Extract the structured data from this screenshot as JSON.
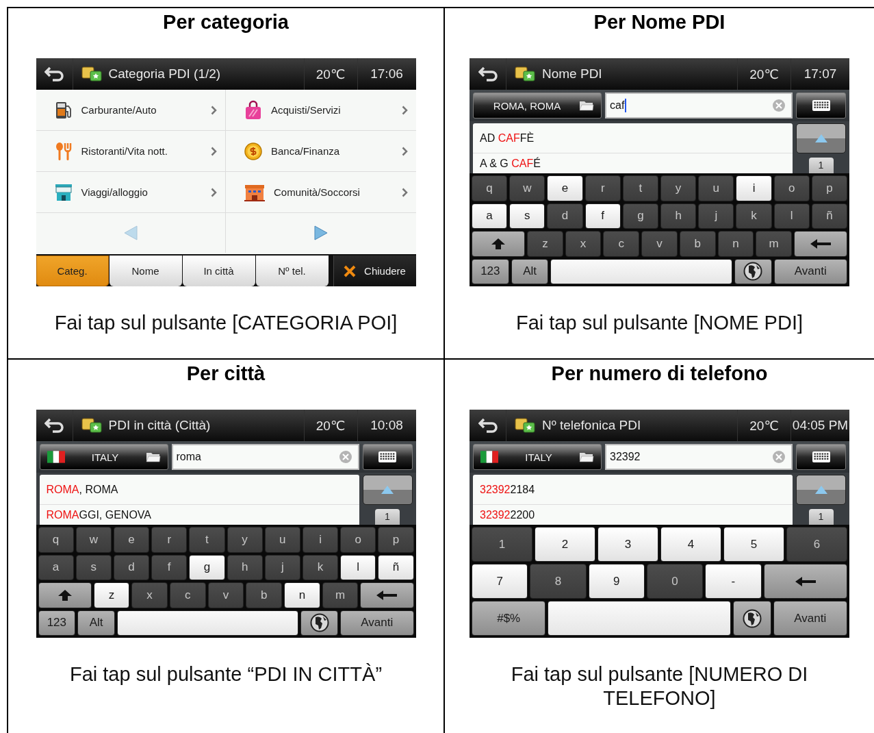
{
  "cells": [
    {
      "heading": "Per categoria",
      "caption": "Fai tap sul pulsante [CATEGORIA POI]",
      "screen": {
        "kind": "category",
        "title": "Categoria PDI (1/2)",
        "temperature": "20℃",
        "time": "17:06",
        "categories": [
          {
            "label": "Carburante/Auto"
          },
          {
            "label": "Acquisti/Servizi"
          },
          {
            "label": "Ristoranti/Vita nott."
          },
          {
            "label": "Banca/Finanza"
          },
          {
            "label": "Viaggi/alloggio"
          },
          {
            "label": "Comunità/Soccorsi"
          }
        ],
        "pager": {
          "previous_enabled": false,
          "next_enabled": true
        },
        "tabs": [
          {
            "label": "Categ.",
            "selected": true
          },
          {
            "label": "Nome",
            "selected": false
          },
          {
            "label": "In città",
            "selected": false
          },
          {
            "label": "Nº tel.",
            "selected": false
          }
        ],
        "close": "Chiudere"
      }
    },
    {
      "heading": "Per Nome PDI",
      "caption": "Fai tap sul pulsante [NOME PDI]",
      "screen": {
        "kind": "search",
        "title": "Nome PDI",
        "temperature": "20℃",
        "time": "17:07",
        "region": {
          "label": "ROMA, ROMA",
          "flag": false
        },
        "query": "caf",
        "cursor": true,
        "results": [
          {
            "before": "AD ",
            "match": "CAF",
            "after": "FÈ"
          },
          {
            "before": "A & G ",
            "match": "CAF",
            "after": "É"
          }
        ],
        "page": "1",
        "keyboard": [
          [
            {
              "kind": "char",
              "label": "q",
              "lit": false
            },
            {
              "kind": "char",
              "label": "w",
              "lit": false
            },
            {
              "kind": "char",
              "label": "e",
              "lit": true
            },
            {
              "kind": "char",
              "label": "r",
              "lit": false
            },
            {
              "kind": "char",
              "label": "t",
              "lit": false
            },
            {
              "kind": "char",
              "label": "y",
              "lit": false
            },
            {
              "kind": "char",
              "label": "u",
              "lit": false
            },
            {
              "kind": "char",
              "label": "i",
              "lit": true
            },
            {
              "kind": "char",
              "label": "o",
              "lit": false
            },
            {
              "kind": "char",
              "label": "p",
              "lit": false
            }
          ],
          [
            {
              "kind": "char",
              "label": "a",
              "lit": true
            },
            {
              "kind": "char",
              "label": "s",
              "lit": true
            },
            {
              "kind": "char",
              "label": "d",
              "lit": false
            },
            {
              "kind": "char",
              "label": "f",
              "lit": true
            },
            {
              "kind": "char",
              "label": "g",
              "lit": false
            },
            {
              "kind": "char",
              "label": "h",
              "lit": false
            },
            {
              "kind": "char",
              "label": "j",
              "lit": false
            },
            {
              "kind": "char",
              "label": "k",
              "lit": false
            },
            {
              "kind": "char",
              "label": "l",
              "lit": false
            },
            {
              "kind": "char",
              "label": "ñ",
              "lit": false
            }
          ],
          [
            {
              "kind": "shift"
            },
            {
              "kind": "char",
              "label": "z",
              "lit": false
            },
            {
              "kind": "char",
              "label": "x",
              "lit": false
            },
            {
              "kind": "char",
              "label": "c",
              "lit": false
            },
            {
              "kind": "char",
              "label": "v",
              "lit": false
            },
            {
              "kind": "char",
              "label": "b",
              "lit": false
            },
            {
              "kind": "char",
              "label": "n",
              "lit": false
            },
            {
              "kind": "char",
              "label": "m",
              "lit": false
            },
            {
              "kind": "back"
            }
          ],
          [
            {
              "kind": "function",
              "label": "123"
            },
            {
              "kind": "function",
              "label": "Alt"
            },
            {
              "kind": "space"
            },
            {
              "kind": "globe"
            },
            {
              "kind": "function",
              "label": "Avanti"
            }
          ]
        ]
      }
    },
    {
      "heading": "Per città",
      "caption": "Fai tap sul pulsante “PDI IN CITTÀ”",
      "screen": {
        "kind": "search",
        "title": "PDI in città (Città)",
        "temperature": "20℃",
        "time": "10:08",
        "region": {
          "label": "ITALY",
          "flag": true
        },
        "query": "roma",
        "cursor": false,
        "results": [
          {
            "match": "ROMA",
            "after": ", ROMA"
          },
          {
            "match": "ROMA",
            "after": "GGI, GENOVA"
          }
        ],
        "page": "1",
        "keyboard": [
          [
            {
              "kind": "char",
              "label": "q",
              "lit": false
            },
            {
              "kind": "char",
              "label": "w",
              "lit": false
            },
            {
              "kind": "char",
              "label": "e",
              "lit": false
            },
            {
              "kind": "char",
              "label": "r",
              "lit": false
            },
            {
              "kind": "char",
              "label": "t",
              "lit": false
            },
            {
              "kind": "char",
              "label": "y",
              "lit": false
            },
            {
              "kind": "char",
              "label": "u",
              "lit": false
            },
            {
              "kind": "char",
              "label": "i",
              "lit": false
            },
            {
              "kind": "char",
              "label": "o",
              "lit": false
            },
            {
              "kind": "char",
              "label": "p",
              "lit": false
            }
          ],
          [
            {
              "kind": "char",
              "label": "a",
              "lit": false
            },
            {
              "kind": "char",
              "label": "s",
              "lit": false
            },
            {
              "kind": "char",
              "label": "d",
              "lit": false
            },
            {
              "kind": "char",
              "label": "f",
              "lit": false
            },
            {
              "kind": "char",
              "label": "g",
              "lit": true
            },
            {
              "kind": "char",
              "label": "h",
              "lit": false
            },
            {
              "kind": "char",
              "label": "j",
              "lit": false
            },
            {
              "kind": "char",
              "label": "k",
              "lit": false
            },
            {
              "kind": "char",
              "label": "l",
              "lit": true
            },
            {
              "kind": "char",
              "label": "ñ",
              "lit": true
            }
          ],
          [
            {
              "kind": "shift"
            },
            {
              "kind": "char",
              "label": "z",
              "lit": true
            },
            {
              "kind": "char",
              "label": "x",
              "lit": false
            },
            {
              "kind": "char",
              "label": "c",
              "lit": false
            },
            {
              "kind": "char",
              "label": "v",
              "lit": false
            },
            {
              "kind": "char",
              "label": "b",
              "lit": false
            },
            {
              "kind": "char",
              "label": "n",
              "lit": true
            },
            {
              "kind": "char",
              "label": "m",
              "lit": false
            },
            {
              "kind": "back"
            }
          ],
          [
            {
              "kind": "function",
              "label": "123"
            },
            {
              "kind": "function",
              "label": "Alt"
            },
            {
              "kind": "space"
            },
            {
              "kind": "globe"
            },
            {
              "kind": "function",
              "label": "Avanti"
            }
          ]
        ]
      }
    },
    {
      "heading": "Per numero di telefono",
      "caption": "Fai tap sul pulsante [NUMERO DI TELEFONO]",
      "screen": {
        "kind": "search",
        "title": "Nº telefonica PDI",
        "temperature": "20℃",
        "time": "04:05 PM",
        "region": {
          "label": "ITALY",
          "flag": true
        },
        "query": "32392",
        "cursor": false,
        "results": [
          {
            "match": "32392",
            "after": "2184"
          },
          {
            "match": "32392",
            "after": "2200"
          }
        ],
        "page": "1",
        "keyboard": [
          [
            {
              "kind": "char",
              "label": "1",
              "lit": false
            },
            {
              "kind": "char",
              "label": "2",
              "lit": true
            },
            {
              "kind": "char",
              "label": "3",
              "lit": true
            },
            {
              "kind": "char",
              "label": "4",
              "lit": true
            },
            {
              "kind": "char",
              "label": "5",
              "lit": true
            },
            {
              "kind": "char",
              "label": "6",
              "lit": false
            }
          ],
          [
            {
              "kind": "char",
              "label": "7",
              "lit": true
            },
            {
              "kind": "char",
              "label": "8",
              "lit": false
            },
            {
              "kind": "char",
              "label": "9",
              "lit": true
            },
            {
              "kind": "char",
              "label": "0",
              "lit": false
            },
            {
              "kind": "char",
              "label": "-",
              "lit": true
            },
            {
              "kind": "back"
            }
          ],
          [
            {
              "kind": "function",
              "label": "#$%"
            },
            {
              "kind": "space"
            },
            {
              "kind": "globe"
            },
            {
              "kind": "function",
              "label": "Avanti"
            }
          ]
        ]
      }
    }
  ]
}
